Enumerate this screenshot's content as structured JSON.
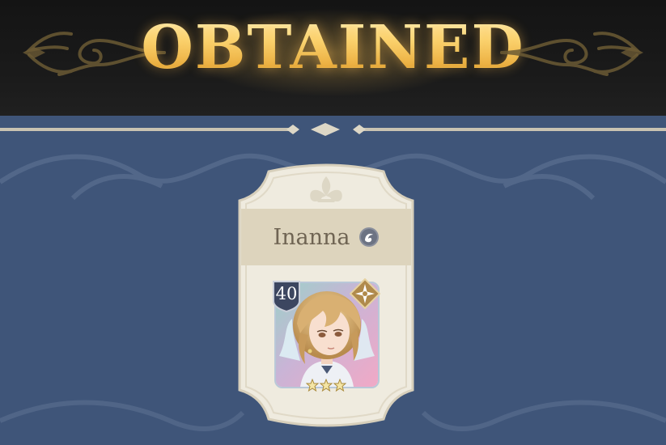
{
  "banner": {
    "title": "OBTAINED"
  },
  "reward": {
    "character_name": "Inanna",
    "level": "40",
    "rarity_stars": 3,
    "element_icon": "wind-swirl-icon",
    "class_icon": "compass-star-icon"
  },
  "colors": {
    "background": "#3f5579",
    "banner": "#161616",
    "gold": "#f6cf63",
    "card": "#efebdf",
    "name_band": "#ddd4bd",
    "name_text": "#6f6453"
  }
}
